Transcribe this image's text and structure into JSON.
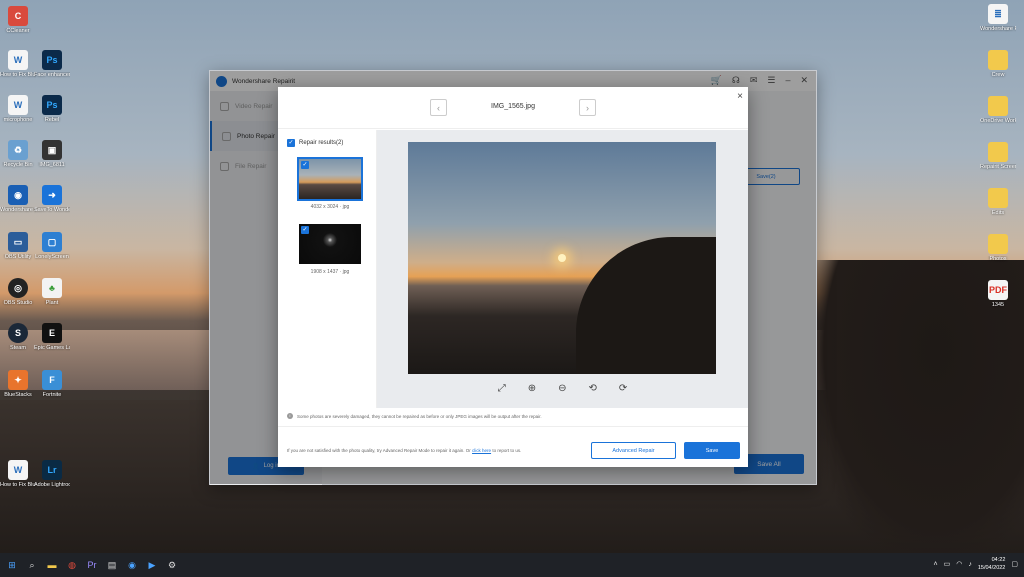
{
  "desktop": {
    "left_icons": [
      {
        "label": "CCleaner",
        "icon": "ccleaner-icon",
        "color": "#d94a3d"
      },
      {
        "label": "How to Fix Blurry Phot...",
        "icon": "document-icon",
        "color": "#f5f5f5"
      },
      {
        "label": "Face enhancement",
        "icon": "photoshop-icon",
        "color": "#0b2a4a"
      },
      {
        "label": "microphone",
        "icon": "document-icon",
        "color": "#f5f5f5"
      },
      {
        "label": "Rebel",
        "icon": "photoshop-icon",
        "color": "#0b2a4a"
      },
      {
        "label": "Recycle Bin",
        "icon": "recycle-bin-icon",
        "color": "#6aa0d0"
      },
      {
        "label": "IMG_6811",
        "icon": "image-icon",
        "color": "#333333"
      },
      {
        "label": "Wondershare Repairit",
        "icon": "repairit-icon",
        "color": "#1a5fb4"
      },
      {
        "label": "SaveTo Wondershare",
        "icon": "arrow-icon",
        "color": "#1a73d9"
      },
      {
        "label": "OBS Utility",
        "icon": "computer-icon",
        "color": "#2b5d9a"
      },
      {
        "label": "LonelyScreen",
        "icon": "screen-icon",
        "color": "#2d7fd2"
      },
      {
        "label": "OBS Studio",
        "icon": "obs-icon",
        "color": "#222222"
      },
      {
        "label": "Plant",
        "icon": "clover-icon",
        "color": "#f3f3f3"
      },
      {
        "label": "Steam",
        "icon": "steam-icon",
        "color": "#1b2838"
      },
      {
        "label": "Epic Games Launcher",
        "icon": "epic-icon",
        "color": "#111111"
      },
      {
        "label": "BlueStacks",
        "icon": "bluestacks-icon",
        "color": "#e8742d"
      },
      {
        "label": "Fortnite",
        "icon": "fortnite-icon",
        "color": "#3a8fd6"
      },
      {
        "label": "How to Fix Blurry Phot...",
        "icon": "document-icon",
        "color": "#f5f5f5"
      },
      {
        "label": "Adobe Lightroo...",
        "icon": "lightroom-icon",
        "color": "#0a2a44"
      }
    ],
    "right_icons": [
      {
        "label": "Wondershare Repairit 2022",
        "icon": "document-icon",
        "color": "#f5f5f5"
      },
      {
        "label": "Crew",
        "icon": "folder-icon",
        "color": "#f2c94c"
      },
      {
        "label": "OneDrive Work",
        "icon": "folder-icon",
        "color": "#f2c94c"
      },
      {
        "label": "Repairit Screenshots",
        "icon": "folder-icon",
        "color": "#f2c94c"
      },
      {
        "label": "Edits",
        "icon": "folder-icon",
        "color": "#f2c94c"
      },
      {
        "label": "Photos",
        "icon": "folder-icon",
        "color": "#f2c94c"
      },
      {
        "label": "1345",
        "icon": "pdf-icon",
        "color": "#f5f5f5"
      }
    ]
  },
  "app": {
    "title": "Wondershare Repairit",
    "sidebar": [
      {
        "label": "Video Repair"
      },
      {
        "label": "Photo Repair"
      },
      {
        "label": "File Repair"
      }
    ],
    "login_label": "Log in",
    "save_all_label": "Save All",
    "bg_save_label": "Save(2)"
  },
  "modal": {
    "file_name": "IMG_1565.jpg",
    "prev_symbol": "‹",
    "next_symbol": "›",
    "close_symbol": "×",
    "results_label": "Repair results(2)",
    "thumbnails": [
      {
        "caption": "4032 x 3024 · jpg"
      },
      {
        "caption": "1908 x 1437 · jpg"
      }
    ],
    "notice": "Some photos are severely damaged, they cannot be repaired as before or only JPEG images will be output after the repair.",
    "footer_text": "If you are not satisfied with the photo quality, try Advanced Repair Mode to repair it again. Or",
    "footer_link": "click here",
    "footer_tail": "to report to us.",
    "advanced_label": "Advanced Repair",
    "save_label": "Save"
  },
  "taskbar": {
    "time": "04:22",
    "date": "15/04/2022"
  },
  "colors": {
    "accent": "#1a73d9",
    "taskbar": "#1f2227"
  }
}
